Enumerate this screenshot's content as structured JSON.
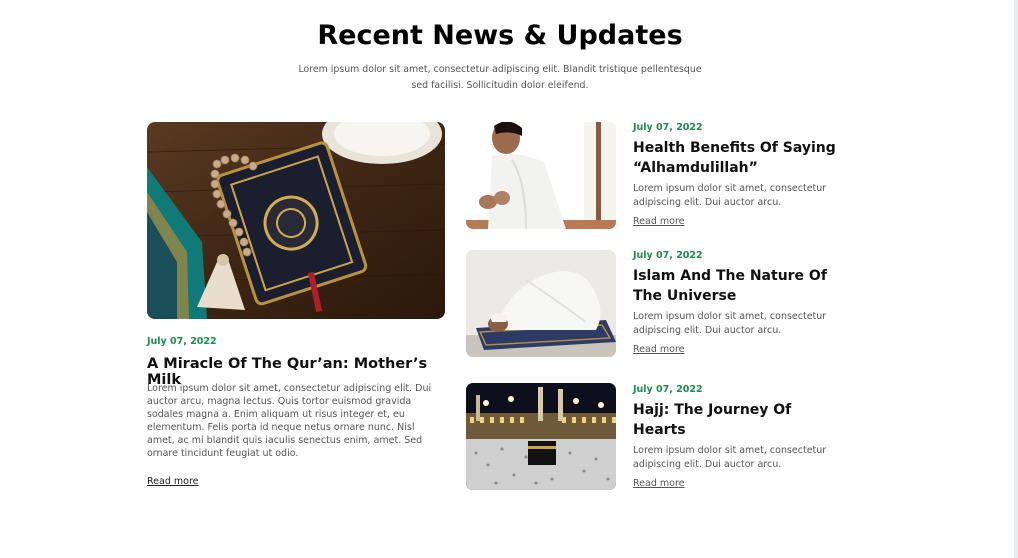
{
  "section": {
    "title": "Recent News & Updates",
    "subtitle": "Lorem ipsum dolor sit amet, consectetur adipiscing elit. Blandit tristique pellentesque sed facilisi. Sollicitudin dolor eleifend."
  },
  "featured": {
    "date": "July 07, 2022",
    "title": "A Miracle Of The Qur’an: Mother’s Milk",
    "body": "Lorem ipsum dolor sit amet, consectetur adipiscing elit. Dui auctor arcu, magna lectus. Quis tortor euismod gravida sodales magna a. Enim aliquam ut risus integer et, eu elementum. Felis porta id neque netus ornare nunc. Nisl amet, ac mi blandit quis iaculis senectus enim, amet. Sed ornare tincidunt feugiat ut odio.",
    "read_more": "Read more",
    "image_icon": "quran-rosary-image"
  },
  "side_articles": [
    {
      "date": "July 07, 2022",
      "title": "Health Benefits Of Saying “Alhamdulillah”",
      "body": "Lorem ipsum dolor sit amet, consectetur adipiscing elit. Dui auctor arcu.",
      "read_more": "Read more",
      "image_icon": "praying-man-image"
    },
    {
      "date": "July 07, 2022",
      "title": "Islam And The Nature Of The Universe",
      "body": "Lorem ipsum dolor sit amet, consectetur adipiscing elit. Dui auctor arcu.",
      "read_more": "Read more",
      "image_icon": "prostrating-man-image"
    },
    {
      "date": "July 07, 2022",
      "title": "Hajj: The Journey Of Hearts",
      "body": "Lorem ipsum dolor sit amet, consectetur adipiscing elit. Dui auctor arcu.",
      "read_more": "Read more",
      "image_icon": "kaaba-hajj-image"
    }
  ],
  "colors": {
    "accent_green": "#1c8d4e",
    "text_dark": "#111111",
    "text_muted": "#555555"
  }
}
